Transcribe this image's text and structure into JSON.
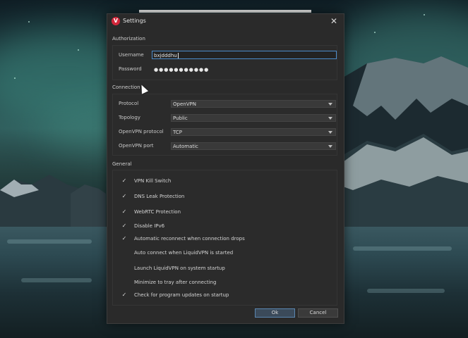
{
  "window": {
    "title": "Settings",
    "close_glyph": "✕",
    "app_icon": "liquidvpn-logo-icon",
    "accent_color": "#d2263a"
  },
  "authorization": {
    "section_label": "Authorization",
    "username_label": "Username",
    "username_value": "bxjdddhu",
    "password_label": "Password",
    "password_value": "●●●●●●●●●●●"
  },
  "connection": {
    "section_label": "Connection",
    "fields": [
      {
        "label": "Protocol",
        "value": "OpenVPN"
      },
      {
        "label": "Topology",
        "value": "Public"
      },
      {
        "label": "OpenVPN protocol",
        "value": "TCP"
      },
      {
        "label": "OpenVPN port",
        "value": "Automatic"
      }
    ]
  },
  "general": {
    "section_label": "General",
    "options": [
      {
        "label": "VPN Kill Switch",
        "checked": true
      },
      {
        "label": "DNS Leak Protection",
        "checked": true
      },
      {
        "label": "WebRTC Protection",
        "checked": true
      },
      {
        "label": "Disable IPv6",
        "checked": true
      },
      {
        "label": "Automatic reconnect when connection drops",
        "checked": true
      },
      {
        "label": "Auto connect when LiquidVPN is started",
        "checked": false
      },
      {
        "label": "Launch LiquidVPN on system startup",
        "checked": false
      },
      {
        "label": "Minimize to tray after connecting",
        "checked": false
      },
      {
        "label": "Check for program updates on startup",
        "checked": true
      }
    ]
  },
  "buttons": {
    "ok": "Ok",
    "cancel": "Cancel"
  },
  "check_glyph": "✓"
}
